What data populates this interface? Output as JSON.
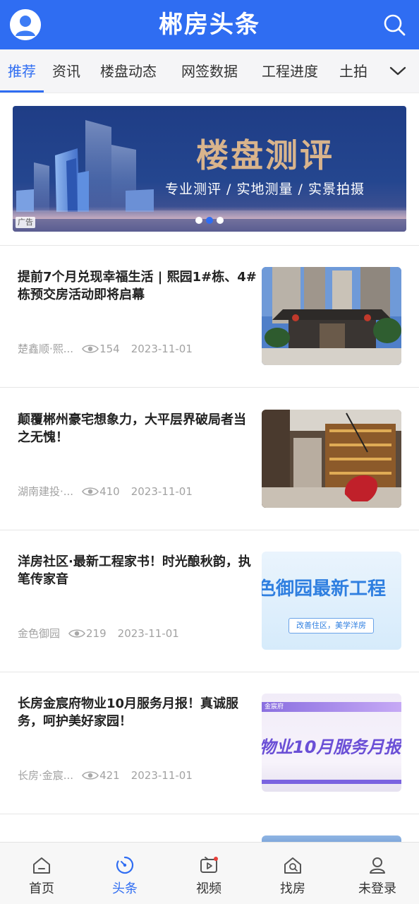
{
  "header": {
    "title": "郴房头条",
    "avatar_icon": "user-avatar-icon",
    "search_icon": "search-icon",
    "brand_color": "#2f6df2"
  },
  "tabs": [
    {
      "label": "推荐",
      "active": true
    },
    {
      "label": "资讯"
    },
    {
      "label": "楼盘动态"
    },
    {
      "label": "网签数据"
    },
    {
      "label": "工程进度"
    },
    {
      "label": "土拍"
    }
  ],
  "tabs_more_icon": "chevron-down-icon",
  "banner": {
    "title": "楼盘测评",
    "subtitle": "专业测评 / 实地测量 / 实景拍摄",
    "ad_label": "广告",
    "slide_count": 3,
    "active_slide": 2
  },
  "articles": [
    {
      "title": "提前7个月兑现幸福生活 | 熙园1#栋、4#栋预交房活动即将启幕",
      "source": "楚鑫顺·熙...",
      "views": "154",
      "date": "2023-11-01"
    },
    {
      "title": "颠覆郴州豪宅想象力，大平层界破局者当之无愧！",
      "source": "湖南建投·...",
      "views": "410",
      "date": "2023-11-01"
    },
    {
      "title": "洋房社区·最新工程家书！时光酿秋韵，执笔传家音",
      "source": "金色御园",
      "views": "219",
      "date": "2023-11-01",
      "thumb_text": "色御园最新工程",
      "thumb_tag": "改善住区，美学洋房"
    },
    {
      "title": "长房金宸府物业10月服务月报！真诚服务，呵护美好家园！",
      "source": "长房·金宸...",
      "views": "421",
      "date": "2023-11-01",
      "thumb_text": "物业10月服务月报",
      "thumb_tag": "金宸府"
    }
  ],
  "bottom_nav": [
    {
      "label": "首页",
      "icon": "home-icon"
    },
    {
      "label": "头条",
      "icon": "headline-icon",
      "active": true
    },
    {
      "label": "视频",
      "icon": "video-icon"
    },
    {
      "label": "找房",
      "icon": "find-house-icon"
    },
    {
      "label": "未登录",
      "icon": "user-icon"
    }
  ]
}
